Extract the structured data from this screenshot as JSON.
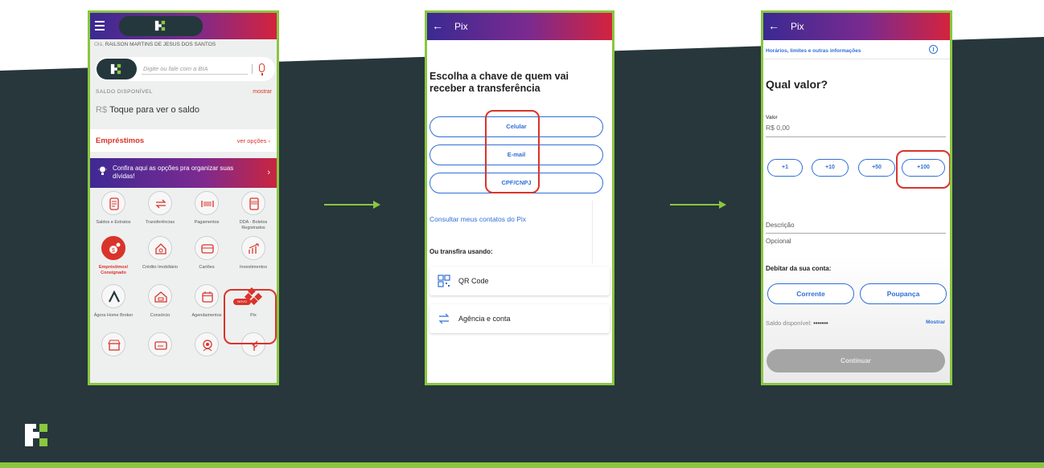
{
  "colors": {
    "accent_green": "#8ac640",
    "dark_bg": "#27373b",
    "highlight_red": "#d9342b",
    "link_blue": "#2f6fd6"
  },
  "phone1": {
    "greeting_prefix": "Olá,",
    "user_name": "RAILSON MARTINS DE JESUS DOS SANTOS",
    "search_placeholder": "Digite ou fale com a BIA",
    "saldo_label": "SALDO DISPONÍVEL",
    "saldo_show": "mostrar",
    "currency": "R$",
    "saldo_prompt": "Toque para ver o saldo",
    "emprestimos_title": "Empréstimos",
    "emprestimos_link": "ver opções",
    "banner_text": "Confira aqui as opções pra organizar suas dívidas!",
    "novo_badge": "NOVO",
    "grid": [
      {
        "label": "Saldos e Extratos",
        "icon": "statement-icon"
      },
      {
        "label": "Transferências",
        "icon": "transfer-icon"
      },
      {
        "label": "Pagamentos",
        "icon": "barcode-icon"
      },
      {
        "label": "DDA - Boletos Registrados",
        "icon": "boleto-icon"
      },
      {
        "label": "Empréstimos/ Consignado",
        "icon": "loan-icon"
      },
      {
        "label": "Crédito Imobiliário",
        "icon": "house-icon"
      },
      {
        "label": "Cartões",
        "icon": "card-icon"
      },
      {
        "label": "Investimentos",
        "icon": "chart-up-icon"
      },
      {
        "label": "Ágora Home Broker",
        "icon": "agora-icon"
      },
      {
        "label": "Consórcio",
        "icon": "consorcio-icon"
      },
      {
        "label": "Agendamentos",
        "icon": "calendar-icon"
      },
      {
        "label": "Pix",
        "icon": "pix-icon"
      }
    ]
  },
  "phone2": {
    "title": "Pix",
    "heading": "Escolha a chave de quem vai receber a transferência",
    "options": [
      "Celular",
      "E-mail",
      "CPF/CNPJ"
    ],
    "contacts_link": "Consultar meus contatos do Pix",
    "alt_label": "Ou transfira usando:",
    "alt_options": [
      "QR Code",
      "Agência e conta"
    ]
  },
  "phone3": {
    "title": "Pix",
    "info_link": "Horários, limites e outras informações",
    "heading": "Qual valor?",
    "valor_label": "Valor",
    "valor_value": "R$ 0,00",
    "chips": [
      "+1",
      "+10",
      "+50",
      "+100"
    ],
    "descricao_label": "Descrição",
    "descricao_placeholder": "Opcional",
    "debit_label": "Debitar da sua conta:",
    "accounts": [
      "Corrente",
      "Poupança"
    ],
    "saldo_label": "Saldo disponível:",
    "saldo_masked": "•••••••",
    "saldo_show": "Mostrar",
    "continue_label": "Continuar"
  }
}
